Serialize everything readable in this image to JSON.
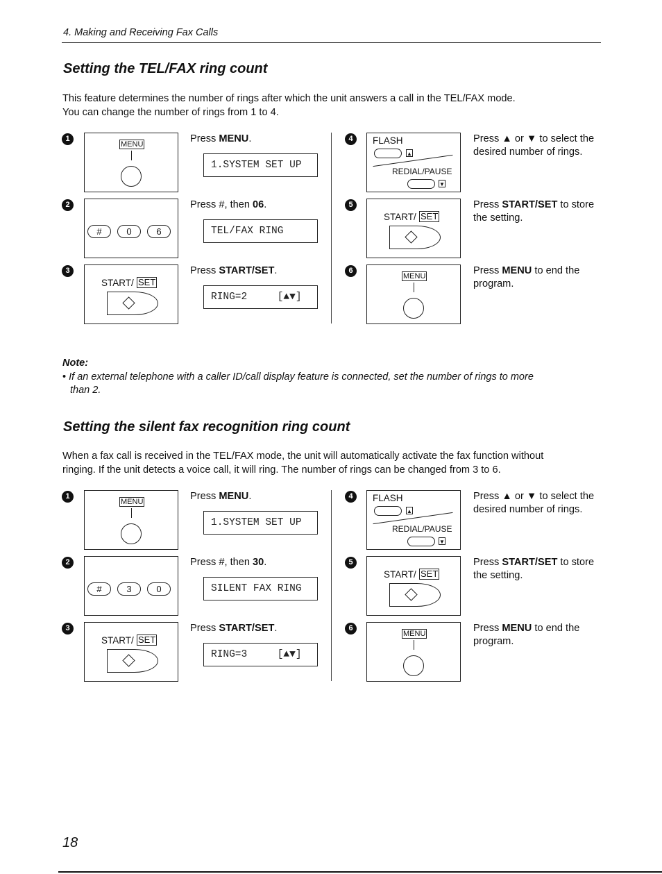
{
  "running_head": "4.  Making and Receiving Fax Calls",
  "page_number": "18",
  "sections": [
    {
      "title": "Setting the TEL/FAX ring count",
      "intro": [
        "This feature determines the number of rings after which the unit answers a call in the TEL/FAX mode.",
        "You can change the number of rings from 1 to 4."
      ],
      "steps": [
        {
          "num": "1",
          "panel": "menu",
          "key_label": "MENU",
          "instr_pre": "Press ",
          "instr_bold": "MENU",
          "instr_post": ".",
          "lcd": "1.SYSTEM SET UP"
        },
        {
          "num": "2",
          "panel": "keys",
          "keys": [
            "#",
            "0",
            "6"
          ],
          "instr_pre": "Press #, then ",
          "instr_bold": "06",
          "instr_post": ".",
          "lcd": "TEL/FAX RING"
        },
        {
          "num": "3",
          "panel": "start",
          "start_label": "START/",
          "set_label": "SET",
          "instr_pre": "Press ",
          "instr_bold": "START/SET",
          "instr_post": ".",
          "lcd": "RING=2     [▲▼]"
        },
        {
          "num": "4",
          "panel": "flash",
          "flash_label": "FLASH",
          "redial_label": "REDIAL/PAUSE",
          "up": "▲",
          "down": "▼",
          "instr_pre": "Press ▲ or ▼ to select the desired number of rings.",
          "instr_bold": "",
          "instr_post": ""
        },
        {
          "num": "5",
          "panel": "start",
          "start_label": "START/",
          "set_label": "SET",
          "instr_pre": "Press ",
          "instr_bold": "START/SET",
          "instr_post": " to store the setting."
        },
        {
          "num": "6",
          "panel": "menu",
          "key_label": "MENU",
          "instr_pre": "Press ",
          "instr_bold": "MENU",
          "instr_post": " to end the program."
        }
      ]
    },
    {
      "title": "Setting the silent fax recognition ring count",
      "intro": [
        "When a fax call is received in the TEL/FAX mode, the unit will automatically activate the fax function without",
        "ringing. If the unit detects a voice call, it will ring. The number of rings can be changed from 3 to 6."
      ],
      "steps": [
        {
          "num": "1",
          "panel": "menu",
          "key_label": "MENU",
          "instr_pre": "Press ",
          "instr_bold": "MENU",
          "instr_post": ".",
          "lcd": "1.SYSTEM SET UP"
        },
        {
          "num": "2",
          "panel": "keys",
          "keys": [
            "#",
            "3",
            "0"
          ],
          "instr_pre": "Press #, then ",
          "instr_bold": "30",
          "instr_post": ".",
          "lcd": "SILENT FAX RING"
        },
        {
          "num": "3",
          "panel": "start",
          "start_label": "START/",
          "set_label": "SET",
          "instr_pre": "Press ",
          "instr_bold": "START/SET",
          "instr_post": ".",
          "lcd": "RING=3     [▲▼]"
        },
        {
          "num": "4",
          "panel": "flash",
          "flash_label": "FLASH",
          "redial_label": "REDIAL/PAUSE",
          "up": "▲",
          "down": "▼",
          "instr_pre": "Press ▲ or ▼ to select the desired number of rings.",
          "instr_bold": "",
          "instr_post": ""
        },
        {
          "num": "5",
          "panel": "start",
          "start_label": "START/",
          "set_label": "SET",
          "instr_pre": "Press ",
          "instr_bold": "START/SET",
          "instr_post": " to store the setting."
        },
        {
          "num": "6",
          "panel": "menu",
          "key_label": "MENU",
          "instr_pre": "Press ",
          "instr_bold": "MENU",
          "instr_post": " to end the program."
        }
      ]
    }
  ],
  "note": {
    "label": "Note:",
    "bullet": "•",
    "text_line1": "If an external telephone with a caller ID/call display feature is connected, set the number of rings to more",
    "text_line2": "than 2."
  }
}
